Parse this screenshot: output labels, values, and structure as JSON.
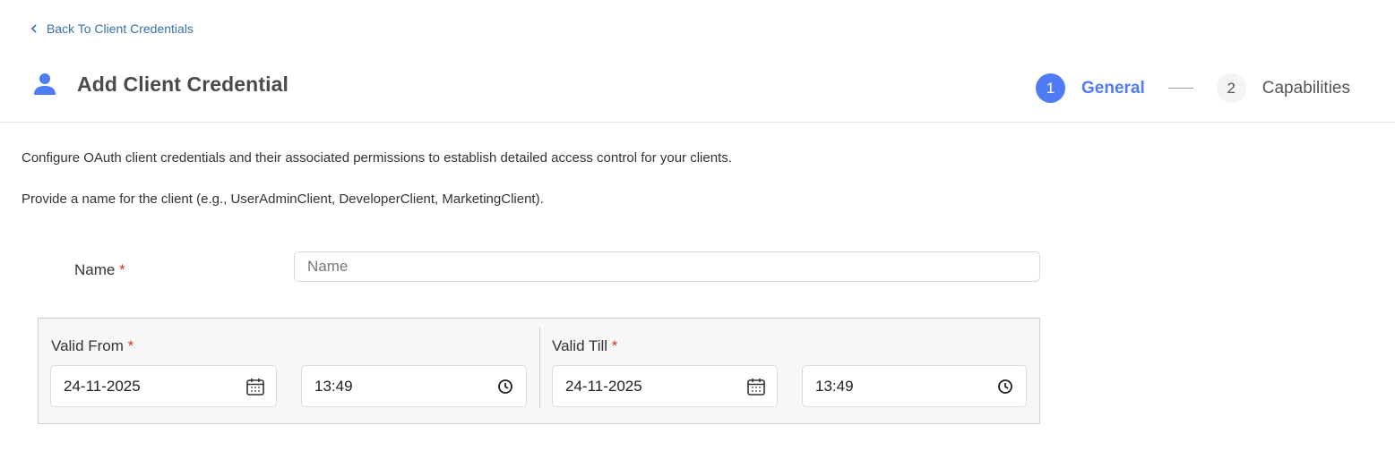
{
  "back_link": {
    "label": "Back To Client Credentials"
  },
  "header": {
    "title": "Add Client Credential"
  },
  "stepper": {
    "steps": [
      {
        "number": "1",
        "label": "General"
      },
      {
        "number": "2",
        "label": "Capabilities"
      }
    ]
  },
  "descriptions": {
    "line1": "Configure OAuth client credentials and their associated permissions to establish detailed access control for your clients.",
    "line2": "Provide a name for the client (e.g., UserAdminClient, DeveloperClient, MarketingClient)."
  },
  "form": {
    "name": {
      "label": "Name",
      "required_mark": "*",
      "placeholder": "Name",
      "value": ""
    },
    "valid_from": {
      "label": "Valid From",
      "required_mark": "*",
      "date": "24-11-2025",
      "time": "13:49"
    },
    "valid_till": {
      "label": "Valid Till",
      "required_mark": "*",
      "date": "24-11-2025",
      "time": "13:49"
    }
  },
  "colors": {
    "accent": "#4f7cf5",
    "link": "#3a6fa8",
    "required": "#d0342c"
  },
  "icons": {
    "back": "chevron-left-icon",
    "user": "user-icon",
    "date": "calendar-icon",
    "time": "clock-icon"
  }
}
